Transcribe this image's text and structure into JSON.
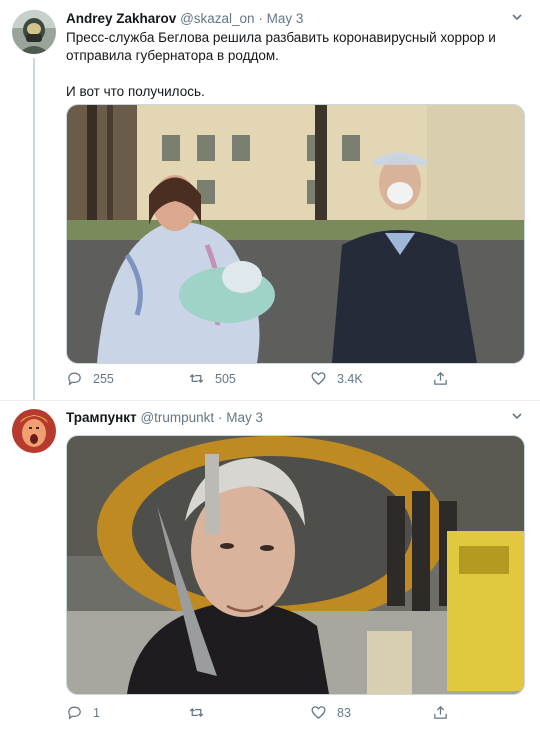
{
  "tweets": [
    {
      "name": "Andrey Zakharov",
      "handle": "@skazal_on",
      "separator": "·",
      "date": "May 3",
      "text_lines": [
        "Пресс-служба Беглова решила разбавить коронавирусный хоррор и",
        "отправила губернатора в роддом."
      ],
      "text_line3": "И вот что получилось.",
      "stats": {
        "replies": "255",
        "retweets": "505",
        "likes": "3.4K"
      }
    },
    {
      "name": "Трампункт",
      "handle": "@trumpunkt",
      "separator": "·",
      "date": "May 3",
      "stats": {
        "replies": "1",
        "retweets": "",
        "likes": "83"
      }
    }
  ],
  "icons": {
    "reply": "reply-icon",
    "retweet": "retweet-icon",
    "like": "heart-icon",
    "share": "share-icon",
    "menu": "chevron-down-icon"
  },
  "colors": {
    "muted": "#657786",
    "text": "#14171a",
    "border": "#ccd6dd"
  }
}
